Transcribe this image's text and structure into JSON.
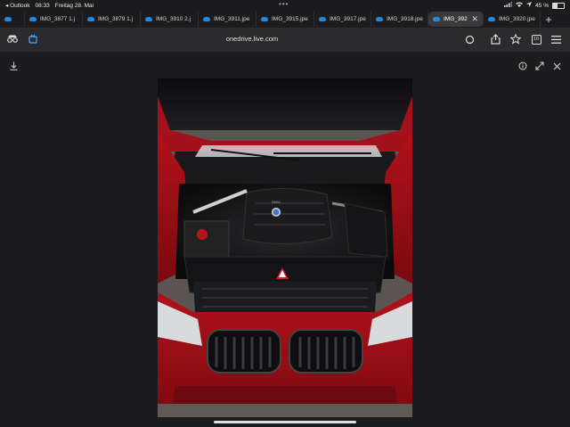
{
  "status_bar": {
    "back_app": "◂ Outlook",
    "time": "08:33",
    "date": "Freitag 28. Mai",
    "dots": "•••",
    "battery_text": "45 %",
    "battery_level": 0.45
  },
  "tabs": [
    {
      "label": "",
      "active": false
    },
    {
      "label": "IMG_3877 1.j",
      "active": false
    },
    {
      "label": "IMG_3879 1.j",
      "active": false
    },
    {
      "label": "IMG_3910 2.j",
      "active": false
    },
    {
      "label": "IMG_3911.jpe",
      "active": false
    },
    {
      "label": "IMG_3915.jpe",
      "active": false
    },
    {
      "label": "IMG_3917.jpe",
      "active": false
    },
    {
      "label": "IMG_3918.jpe",
      "active": false
    },
    {
      "label": "IMG_392",
      "active": true
    },
    {
      "label": "IMG_3920.jpe",
      "active": false
    }
  ],
  "new_tab": "+",
  "close_tab": "✕",
  "toolbar": {
    "url": "onedrive.live.com",
    "tab_count": "10"
  },
  "viewer": {
    "download_icon": "download-icon",
    "info_icon": "info-icon",
    "expand_icon": "expand-icon",
    "close_icon": "close-icon"
  },
  "photo": {
    "description_icon": "car-engine-photo",
    "badge_text": "BMW"
  }
}
